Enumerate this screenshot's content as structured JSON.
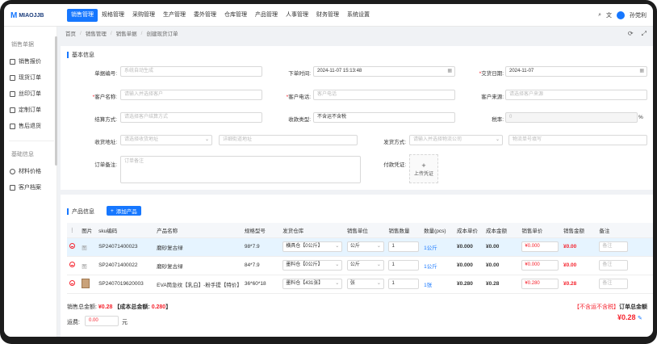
{
  "brand": {
    "name": "MIAOJJB"
  },
  "nav": [
    "销售管理",
    "规格管理",
    "采购管理",
    "生产管理",
    "委外管理",
    "仓库管理",
    "产品管理",
    "人事管理",
    "财务管理",
    "系统设置"
  ],
  "topright": {
    "lang": "文",
    "user": "孙党利"
  },
  "sidebar": {
    "group1": "销售单据",
    "items1": [
      "销售报价",
      "现货订单",
      "丝印订单",
      "定制订单",
      "售后退货"
    ],
    "group2": "基础信息",
    "items2": [
      "材料价格",
      "客户档案"
    ]
  },
  "breadcrumb": [
    "首页",
    "销售管理",
    "销售单据",
    "创建现货订单"
  ],
  "basic": {
    "title": "基本信息",
    "order_no_label": "单据编号:",
    "order_no_ph": "系统自动生成",
    "order_time_label": "下单时间:",
    "order_time_val": "2024-11-07 15:13:48",
    "delivery_label": "交货日期:",
    "delivery_val": "2024-11-07",
    "cust_name_label": "客户名称:",
    "cust_name_ph": "请输入并选择客户",
    "cust_phone_label": "客户电话:",
    "cust_phone_ph": "客户电话",
    "cust_src_label": "客户来源:",
    "cust_src_ph": "请选择客户来源",
    "settle_label": "结算方式:",
    "settle_ph": "请选择客户结算方式",
    "fee_label": "收款类型:",
    "fee_val": "不含运不含税",
    "tax_label": "税率:",
    "tax_val": "0",
    "tax_unit": "%",
    "recv_addr_label": "收货地址:",
    "recv_addr_ph": "请选择收货地址",
    "recv_detail_ph": "详细街道地址",
    "ship_label": "发货方式:",
    "ship_ph": "请输入并选择物流公司",
    "ship_no_ph": "物流单号填写",
    "remark_label": "订单备注:",
    "remark_ph": "订单备注",
    "voucher_label": "付款凭证:",
    "upload_plus": "+",
    "upload_text": "上传凭证"
  },
  "product": {
    "title": "产品信息",
    "add_btn": "添加产品",
    "columns": [
      "",
      "图片",
      "sku编码",
      "产品名称",
      "规格型号",
      "发货仓库",
      "销售单位",
      "销售数量",
      "数量(pcs)",
      "成本单价",
      "成本金额",
      "销售单价",
      "销售金额",
      "备注"
    ],
    "rows": [
      {
        "img": "图",
        "sku": "SP24071400023",
        "name": "磨砂复古绿",
        "spec": "98*7.9",
        "wh": "横具仓【0公斤】",
        "unit": "公斤",
        "qty": "1",
        "pcs": "1公斤",
        "cost": "¥0.000",
        "cost_amt": "¥0.00",
        "price": "¥0.000",
        "amt": "¥0.00",
        "note": "备注"
      },
      {
        "img": "图",
        "sku": "SP24071400022",
        "name": "磨砂复古绿",
        "spec": "84*7.9",
        "wh": "墨料仓【0公斤】",
        "unit": "公斤",
        "qty": "1",
        "pcs": "1公斤",
        "cost": "¥0.000",
        "cost_amt": "¥0.00",
        "price": "¥0.000",
        "amt": "¥0.00",
        "note": "备注"
      },
      {
        "img": "",
        "sku": "SP2407019620003",
        "name": "EVA筒急纹【乳白】-粉手提【特价】",
        "spec": "36*60*18",
        "wh": "墨料仓【431张】",
        "unit": "张",
        "qty": "1",
        "pcs": "1张",
        "cost": "¥0.280",
        "cost_amt": "¥0.28",
        "price": "¥0.280",
        "amt": "¥0.28",
        "note": "备注"
      }
    ]
  },
  "footer": {
    "total_label": "销售总金额:",
    "total_val": "¥0.28",
    "cost_label": "【成本总金额:",
    "cost_val": "0.280",
    "cost_end": "】",
    "freight_label": "运费:",
    "freight_val": "0.00",
    "freight_unit": "元",
    "tax_note": "【不含运不含税】",
    "order_total_label": "订单总金额",
    "order_total_val": "¥0.28"
  },
  "colors": {
    "accent": "#1677ff",
    "danger": "#f5222d"
  }
}
